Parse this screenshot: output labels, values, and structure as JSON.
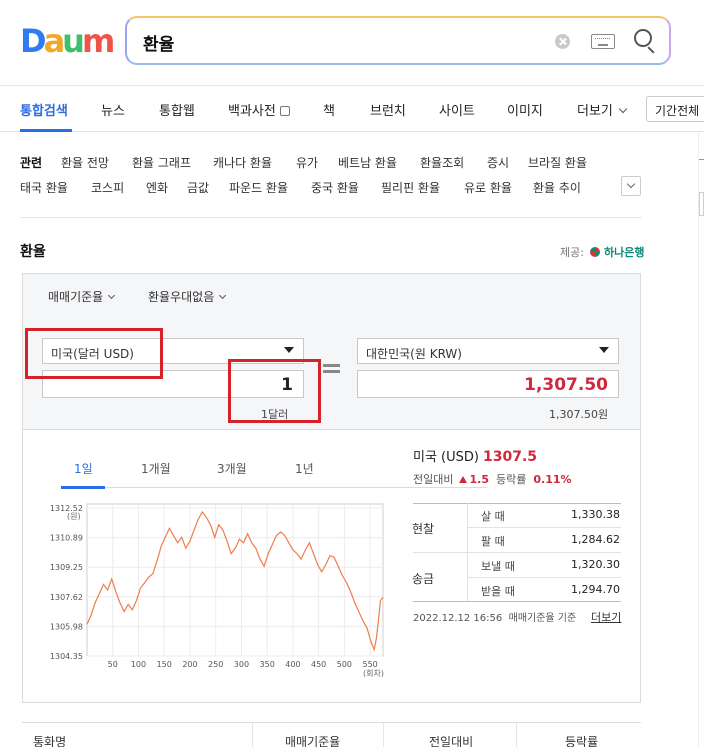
{
  "header": {
    "logo": {
      "d": "D",
      "a": "a",
      "u": "u",
      "m": "m"
    },
    "search_value": "환율"
  },
  "tabs": [
    "통합검색",
    "뉴스",
    "통합웹",
    "백과사전",
    "책",
    "브런치",
    "사이트",
    "이미지",
    "더보기",
    "기간전체"
  ],
  "related": {
    "title": "관련",
    "row1": [
      "환율 전망",
      "환율 그래프",
      "캐나다 환율",
      "유가",
      "베트남 환율",
      "환율조회",
      "증시",
      "브라질 환율"
    ],
    "row2": [
      "태국 환율",
      "코스피",
      "엔화",
      "금값",
      "파운드 환율",
      "중국 환율",
      "필리핀 환율",
      "유로 환율",
      "환율 추이"
    ]
  },
  "exchange": {
    "title": "환율",
    "provider_label": "제공:",
    "provider_name": "하나은행",
    "filter1": "매매기준율",
    "filter2": "환율우대없음",
    "from_currency": "미국(달러 USD)",
    "from_amount": "1",
    "from_caption": "1달러",
    "to_currency": "대한민국(원 KRW)",
    "to_amount": "1,307.50",
    "to_caption": "1,307.50원"
  },
  "chart_tabs": [
    "1일",
    "1개월",
    "3개월",
    "1년"
  ],
  "chart_data": {
    "type": "line",
    "ylabel": "(원)",
    "xlabel": "(회차)",
    "yticks": [
      "1312.52",
      "1310.89",
      "1309.25",
      "1307.62",
      "1305.98",
      "1304.35"
    ],
    "xticks": [
      "50",
      "100",
      "150",
      "200",
      "250",
      "300",
      "350",
      "400",
      "450",
      "500",
      "550"
    ],
    "ylim": [
      1304.35,
      1312.52
    ],
    "xlim": [
      0,
      575
    ],
    "series": [
      {
        "color": "#f07c4c",
        "points": [
          [
            0,
            1306.1
          ],
          [
            8,
            1306.6
          ],
          [
            16,
            1307.3
          ],
          [
            24,
            1307.8
          ],
          [
            32,
            1308.3
          ],
          [
            40,
            1308.0
          ],
          [
            48,
            1308.6
          ],
          [
            56,
            1307.9
          ],
          [
            64,
            1307.3
          ],
          [
            72,
            1306.8
          ],
          [
            80,
            1307.2
          ],
          [
            88,
            1306.9
          ],
          [
            96,
            1307.4
          ],
          [
            104,
            1308.1
          ],
          [
            112,
            1308.4
          ],
          [
            120,
            1308.7
          ],
          [
            128,
            1308.9
          ],
          [
            136,
            1309.6
          ],
          [
            144,
            1310.4
          ],
          [
            152,
            1310.9
          ],
          [
            160,
            1311.4
          ],
          [
            168,
            1311.0
          ],
          [
            176,
            1310.6
          ],
          [
            184,
            1310.9
          ],
          [
            192,
            1310.3
          ],
          [
            200,
            1310.7
          ],
          [
            208,
            1311.3
          ],
          [
            216,
            1311.9
          ],
          [
            224,
            1312.3
          ],
          [
            232,
            1312.0
          ],
          [
            240,
            1311.6
          ],
          [
            248,
            1310.9
          ],
          [
            256,
            1311.6
          ],
          [
            264,
            1311.3
          ],
          [
            272,
            1310.7
          ],
          [
            280,
            1310.0
          ],
          [
            288,
            1310.3
          ],
          [
            296,
            1310.8
          ],
          [
            304,
            1310.6
          ],
          [
            312,
            1311.1
          ],
          [
            320,
            1310.6
          ],
          [
            328,
            1310.3
          ],
          [
            336,
            1309.7
          ],
          [
            344,
            1309.3
          ],
          [
            352,
            1310.0
          ],
          [
            360,
            1310.5
          ],
          [
            368,
            1311.0
          ],
          [
            376,
            1311.2
          ],
          [
            384,
            1311.0
          ],
          [
            392,
            1310.6
          ],
          [
            400,
            1310.2
          ],
          [
            408,
            1310.0
          ],
          [
            416,
            1309.7
          ],
          [
            424,
            1310.2
          ],
          [
            432,
            1310.6
          ],
          [
            440,
            1310.0
          ],
          [
            448,
            1309.4
          ],
          [
            456,
            1309.0
          ],
          [
            464,
            1309.4
          ],
          [
            472,
            1309.9
          ],
          [
            480,
            1309.8
          ],
          [
            488,
            1309.3
          ],
          [
            496,
            1308.8
          ],
          [
            504,
            1308.4
          ],
          [
            512,
            1307.9
          ],
          [
            520,
            1307.3
          ],
          [
            528,
            1306.8
          ],
          [
            536,
            1306.3
          ],
          [
            544,
            1305.9
          ],
          [
            552,
            1305.1
          ],
          [
            558,
            1304.7
          ],
          [
            562,
            1305.3
          ],
          [
            566,
            1306.3
          ],
          [
            570,
            1307.4
          ],
          [
            575,
            1307.6
          ]
        ]
      }
    ]
  },
  "rate": {
    "country": "미국 (USD)",
    "value": "1307.5",
    "compare_label": "전일대비",
    "change": "1.5",
    "pct_label": "등락률",
    "pct": "0.11%",
    "cash_label": "현찰",
    "remit_label": "송금",
    "rows": [
      {
        "label": "살 때",
        "value": "1,330.38"
      },
      {
        "label": "팔 때",
        "value": "1,284.62"
      },
      {
        "label": "보낼 때",
        "value": "1,320.30"
      },
      {
        "label": "받을 때",
        "value": "1,294.70"
      }
    ],
    "timestamp": "2022.12.12 16:56",
    "timestamp_note": "매매기준율 기준",
    "more": "더보기"
  },
  "bottom_table": [
    "통화명",
    "매매기준율",
    "전일대비",
    "등락률"
  ],
  "colors": {
    "accent": "#2b6de6",
    "red": "#d0283c",
    "highlight": "#d6232b",
    "chart_line": "#f07c4c"
  }
}
